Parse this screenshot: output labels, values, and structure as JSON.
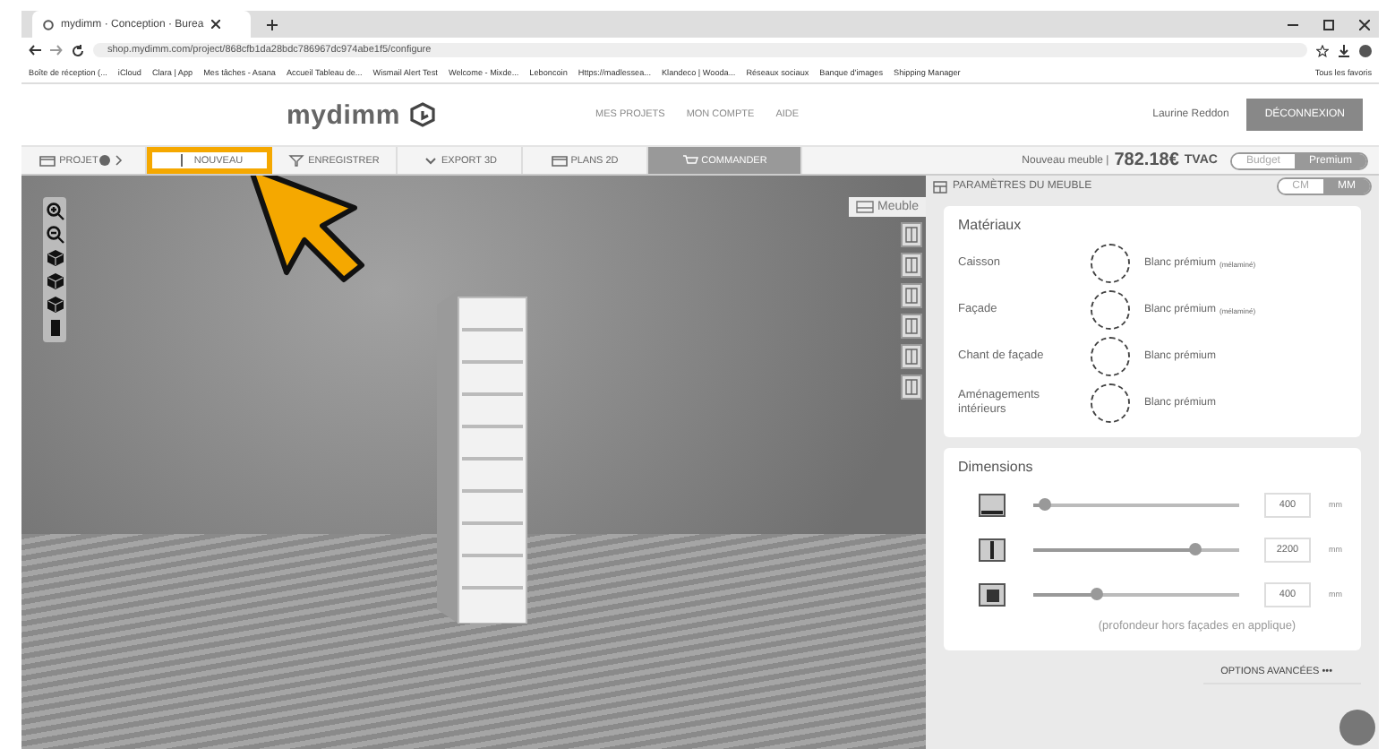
{
  "browser": {
    "tab_title": "mydimm · Conception · Burea",
    "url": "shop.mydimm.com/project/868cfb1da28bdc786967dc974abe1f5/configure",
    "bookmarks": [
      "Boîte de réception (...",
      "iCloud",
      "Clara | App",
      "Mes tâches - Asana",
      "Accueil Tableau de...",
      "Wismail Alert Test",
      "Welcome - Mixde...",
      "Leboncoin",
      "Https://madlessea...",
      "Klandeco | Wooda...",
      "Réseaux sociaux",
      "Banque d'images",
      "Shipping Manager"
    ],
    "all_bookmarks": "Tous les favoris"
  },
  "header": {
    "logo": "mydimm",
    "nav": [
      "MES PROJETS",
      "MON COMPTE",
      "AIDE"
    ],
    "user": "Laurine Reddon",
    "logout": "DÉCONNEXION"
  },
  "toolbar": [
    {
      "label": "PROJET",
      "kind": "project",
      "selected": false
    },
    {
      "label": "NOUVEAU",
      "kind": "new",
      "selected": true
    },
    {
      "label": "ENREGISTRER",
      "kind": "save",
      "selected": false
    },
    {
      "label": "EXPORT 3D",
      "kind": "export",
      "selected": false
    },
    {
      "label": "PLANS 2D",
      "kind": "plans",
      "selected": false
    },
    {
      "label": "COMMANDER",
      "kind": "order",
      "selected": false
    }
  ],
  "viewer": {
    "view_tab": "Meuble"
  },
  "price": {
    "label": "Nouveau meuble |",
    "amount": "782.18€",
    "suffix": "TVAC",
    "ranges": [
      {
        "label": "Budget",
        "selected": false
      },
      {
        "label": "Premium",
        "selected": true
      }
    ]
  },
  "panel": {
    "title": "PARAMÈTRES DU MEUBLE",
    "units": [
      {
        "label": "CM",
        "selected": false
      },
      {
        "label": "MM",
        "selected": true
      }
    ],
    "materials": {
      "title": "Matériaux",
      "items": [
        {
          "label": "Caisson",
          "value": "Blanc prémium",
          "note": "(mélaminé)"
        },
        {
          "label": "Façade",
          "value": "Blanc prémium",
          "note": "(mélaminé)"
        },
        {
          "label": "Chant de façade",
          "value": "Blanc prémium"
        },
        {
          "label": "Aménagements intérieurs",
          "value": "Blanc prémium"
        }
      ]
    },
    "dimensions": {
      "title": "Dimensions",
      "items": [
        {
          "kind": "width",
          "level": 0.05,
          "value": "400",
          "unit": "mm"
        },
        {
          "kind": "height",
          "level": 0.78,
          "value": "2200",
          "unit": "mm"
        },
        {
          "kind": "depth",
          "level": 0.3,
          "value": "400",
          "unit": "mm"
        }
      ],
      "note": "(profondeur hors façades en applique)"
    },
    "advanced": "OPTIONS AVANCÉES •••"
  }
}
